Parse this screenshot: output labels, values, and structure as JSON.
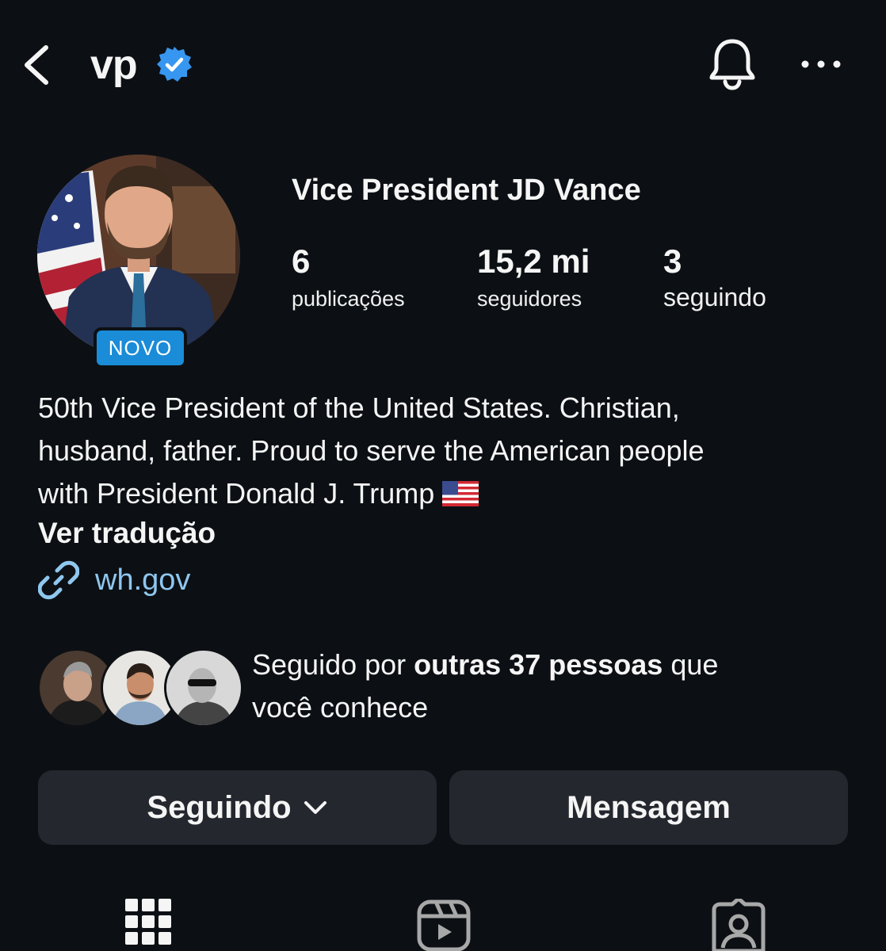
{
  "header": {
    "handle": "vp",
    "verified": true,
    "icons": [
      "back-icon",
      "verified-icon",
      "bell-icon",
      "more-icon"
    ],
    "accent_color": "#3797f0"
  },
  "profile": {
    "avatar_badge": "NOVO",
    "full_name": "Vice President JD Vance",
    "stats": {
      "posts": {
        "value": "6",
        "label": "publicações"
      },
      "followers": {
        "value": "15,2 mi",
        "label": "seguidores"
      },
      "following": {
        "value": "3",
        "label": "seguindo"
      }
    },
    "bio_lines": [
      "50th Vice President of the United States. Christian,",
      "husband, father. Proud to serve the American people",
      "with President Donald J. Trump"
    ],
    "bio_emoji": "us-flag-icon",
    "translate_label": "Ver tradução",
    "link": "wh.gov",
    "link_color": "#8fc7ef"
  },
  "followed_by": {
    "prefix": "Seguido por ",
    "bold": "outras 37 pessoas",
    "suffix": " que",
    "line2": "você conhece"
  },
  "actions": {
    "following_label": "Seguindo",
    "message_label": "Mensagem"
  },
  "tabs": [
    "grid-icon",
    "reels-icon",
    "tagged-icon"
  ]
}
